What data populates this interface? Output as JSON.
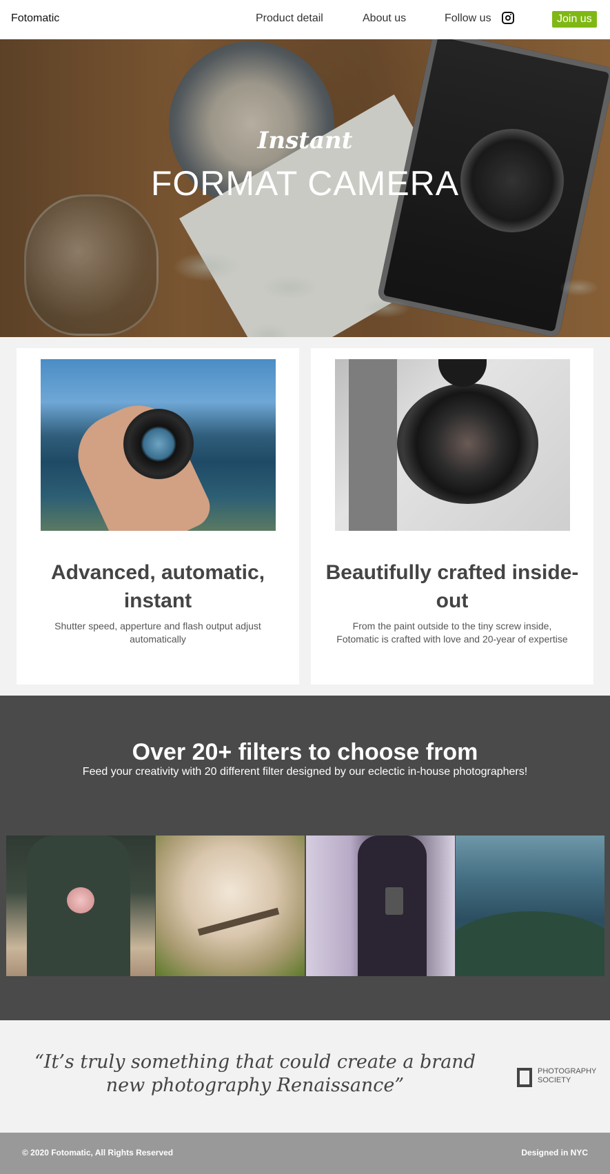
{
  "nav": {
    "logo": "Fotomatic",
    "links": [
      "Product detail",
      "About us",
      "Follow us"
    ],
    "join_label": "Join us"
  },
  "hero": {
    "script": "Instant",
    "title": "FORMAT CAMERA"
  },
  "features": [
    {
      "title": "Advanced, automatic, instant",
      "text": "Shutter speed, apperture and flash output adjust automatically"
    },
    {
      "title": "Beautifully crafted inside-out",
      "text": "From the paint outside to the tiny screw inside, Fotomatic is crafted with love and 20-year of expertise"
    }
  ],
  "filters": {
    "title": "Over 20+ filters to choose from",
    "subtitle": "Feed your creativity with 20 different filter designed by our eclectic in-house photographers!"
  },
  "testimonial": {
    "quote": "“It’s truly something that could create a brand new photography Renaissance”",
    "source": "PHOTOGRAPHY SOCIETY"
  },
  "footer": {
    "copyright": "© 2020 Fotomatic, All Rights Reserved",
    "credit": "Designed in NYC"
  },
  "colors": {
    "accent": "#7fb814",
    "dark_section": "#4a4a4a",
    "footer": "#999999"
  },
  "icons": [
    "instagram-icon",
    "photography-society-logo"
  ]
}
